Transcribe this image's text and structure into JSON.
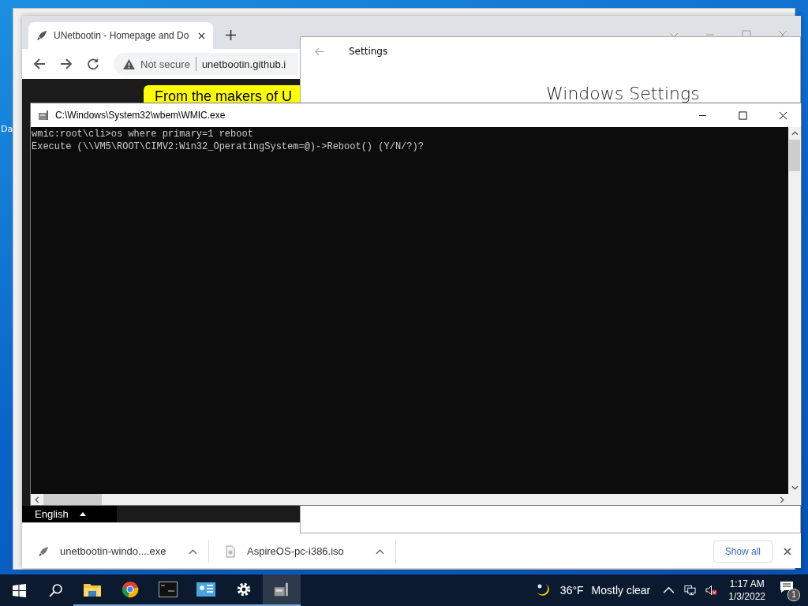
{
  "desktop": {
    "icon_label": "Da"
  },
  "browser": {
    "tabs": [
      {
        "title": "UNetbootin - Homepage and Do",
        "selected": true
      }
    ],
    "security": "Not secure",
    "url": "unetbootin.github.i",
    "banner": "From the makers of U",
    "language": "English",
    "downloads": [
      {
        "name": "unetbootin-windo....exe",
        "kind": "exe"
      },
      {
        "name": "AspireOS-pc-i386.iso",
        "kind": "iso"
      }
    ],
    "show_all": "Show all"
  },
  "settings": {
    "title": "Settings",
    "heading": "Windows Settings"
  },
  "console": {
    "title": "C:\\Windows\\System32\\wbem\\WMIC.exe",
    "lines": [
      "wmic:root\\cli>os where primary=1 reboot",
      "Execute (\\\\VM5\\ROOT\\CIMV2:Win32_OperatingSystem=@)->Reboot() (Y/N/?)?"
    ]
  },
  "taskbar": {
    "apps": [
      {
        "kind": "explorer",
        "selected": false
      },
      {
        "kind": "chrome",
        "selected": false
      },
      {
        "kind": "terminal",
        "selected": false
      },
      {
        "kind": "control",
        "selected": false
      },
      {
        "kind": "settings",
        "selected": false
      },
      {
        "kind": "wmic",
        "selected": true
      }
    ],
    "weather": {
      "temperature": "36°F",
      "condition": "Mostly clear"
    },
    "time": "1:17 AM",
    "date": "1/3/2022",
    "notifications": "1"
  }
}
